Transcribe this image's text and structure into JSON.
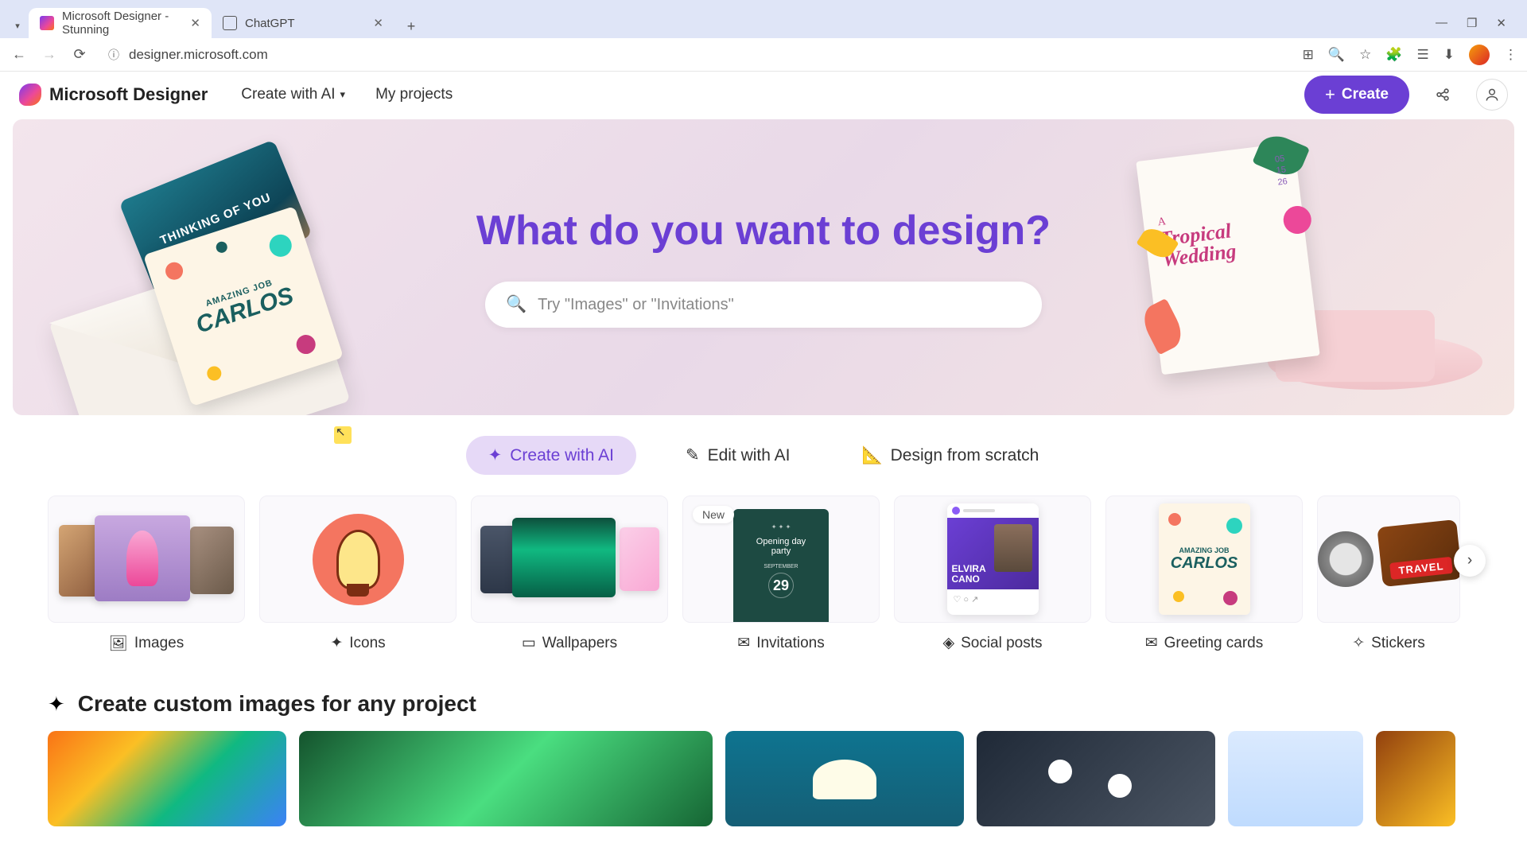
{
  "browser": {
    "tabs": [
      {
        "title": "Microsoft Designer - Stunning",
        "favicon": "designer"
      },
      {
        "title": "ChatGPT",
        "favicon": "chatgpt"
      }
    ],
    "url": "designer.microsoft.com"
  },
  "header": {
    "appName": "Microsoft Designer",
    "nav": {
      "createWithAI": "Create with AI",
      "myProjects": "My projects"
    },
    "createBtn": "Create"
  },
  "hero": {
    "headline": "What do you want to design?",
    "searchPlaceholder": "Try \"Images\" or \"Invitations\"",
    "cardThinking": "THINKING OF YOU",
    "cardCarlos": {
      "small": "AMAZING JOB",
      "big": "CARLOS"
    },
    "tropical": {
      "date1": "05",
      "date2": "15",
      "date3": "26",
      "script": "A",
      "title1": "Tropical",
      "title2": "Wedding"
    }
  },
  "actions": [
    {
      "label": "Create with AI",
      "active": true
    },
    {
      "label": "Edit with AI",
      "active": false
    },
    {
      "label": "Design from scratch",
      "active": false
    }
  ],
  "categories": [
    {
      "label": "Images",
      "icon": "image"
    },
    {
      "label": "Icons",
      "icon": "icon"
    },
    {
      "label": "Wallpapers",
      "icon": "wallpaper"
    },
    {
      "label": "Invitations",
      "icon": "invitation",
      "badge": "New"
    },
    {
      "label": "Social posts",
      "icon": "social"
    },
    {
      "label": "Greeting cards",
      "icon": "greeting"
    },
    {
      "label": "Stickers",
      "icon": "sticker"
    }
  ],
  "invitationThumb": {
    "line1": "Opening day",
    "line2": "party",
    "date": "29",
    "month": "SEPTEMBER"
  },
  "socialThumb": {
    "name1": "ELVIRA",
    "name2": "CANO"
  },
  "greetingThumb": {
    "small": "AMAZING JOB",
    "big": "CARLOS"
  },
  "stickerThumb": {
    "label": "TRAVEL"
  },
  "section": {
    "title": "Create custom images for any project"
  }
}
